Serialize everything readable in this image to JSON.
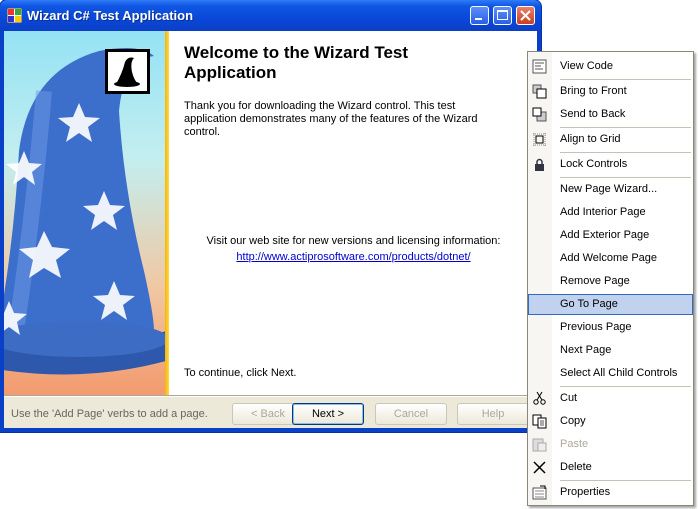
{
  "window": {
    "title": "Wizard C# Test Application"
  },
  "page": {
    "heading": "Welcome to the Wizard Test Application",
    "intro": "Thank you for downloading the Wizard control.  This test application demonstrates many of the features of the Wizard control.",
    "visit_text": "Visit our web site for new versions and licensing information:",
    "link": "http://www.actiprosoftware.com/products/dotnet/",
    "continue_text": "To continue, click Next."
  },
  "footer": {
    "status": "Use the 'Add Page' verbs to add a page.",
    "back": "< Back",
    "next": "Next >",
    "cancel": "Cancel",
    "help": "Help"
  },
  "context_menu": {
    "items": [
      {
        "label": "View Code",
        "icon": "view-code-icon"
      },
      {
        "label": "Bring to Front",
        "icon": "bring-to-front-icon"
      },
      {
        "label": "Send to Back",
        "icon": "send-to-back-icon"
      },
      {
        "label": "Align to Grid",
        "icon": "align-to-grid-icon"
      },
      {
        "label": "Lock Controls",
        "icon": "lock-icon"
      },
      {
        "label": "New Page Wizard..."
      },
      {
        "label": "Add Interior Page"
      },
      {
        "label": "Add Exterior Page"
      },
      {
        "label": "Add Welcome Page"
      },
      {
        "label": "Remove Page"
      },
      {
        "label": "Go To Page",
        "highlighted": true
      },
      {
        "label": "Previous Page"
      },
      {
        "label": "Next Page"
      },
      {
        "label": "Select All Child Controls"
      },
      {
        "label": "Cut",
        "icon": "scissors-icon"
      },
      {
        "label": "Copy",
        "icon": "copy-icon"
      },
      {
        "label": "Paste",
        "icon": "paste-icon",
        "disabled": true
      },
      {
        "label": "Delete",
        "icon": "delete-icon"
      },
      {
        "label": "Properties",
        "icon": "properties-icon"
      }
    ]
  }
}
